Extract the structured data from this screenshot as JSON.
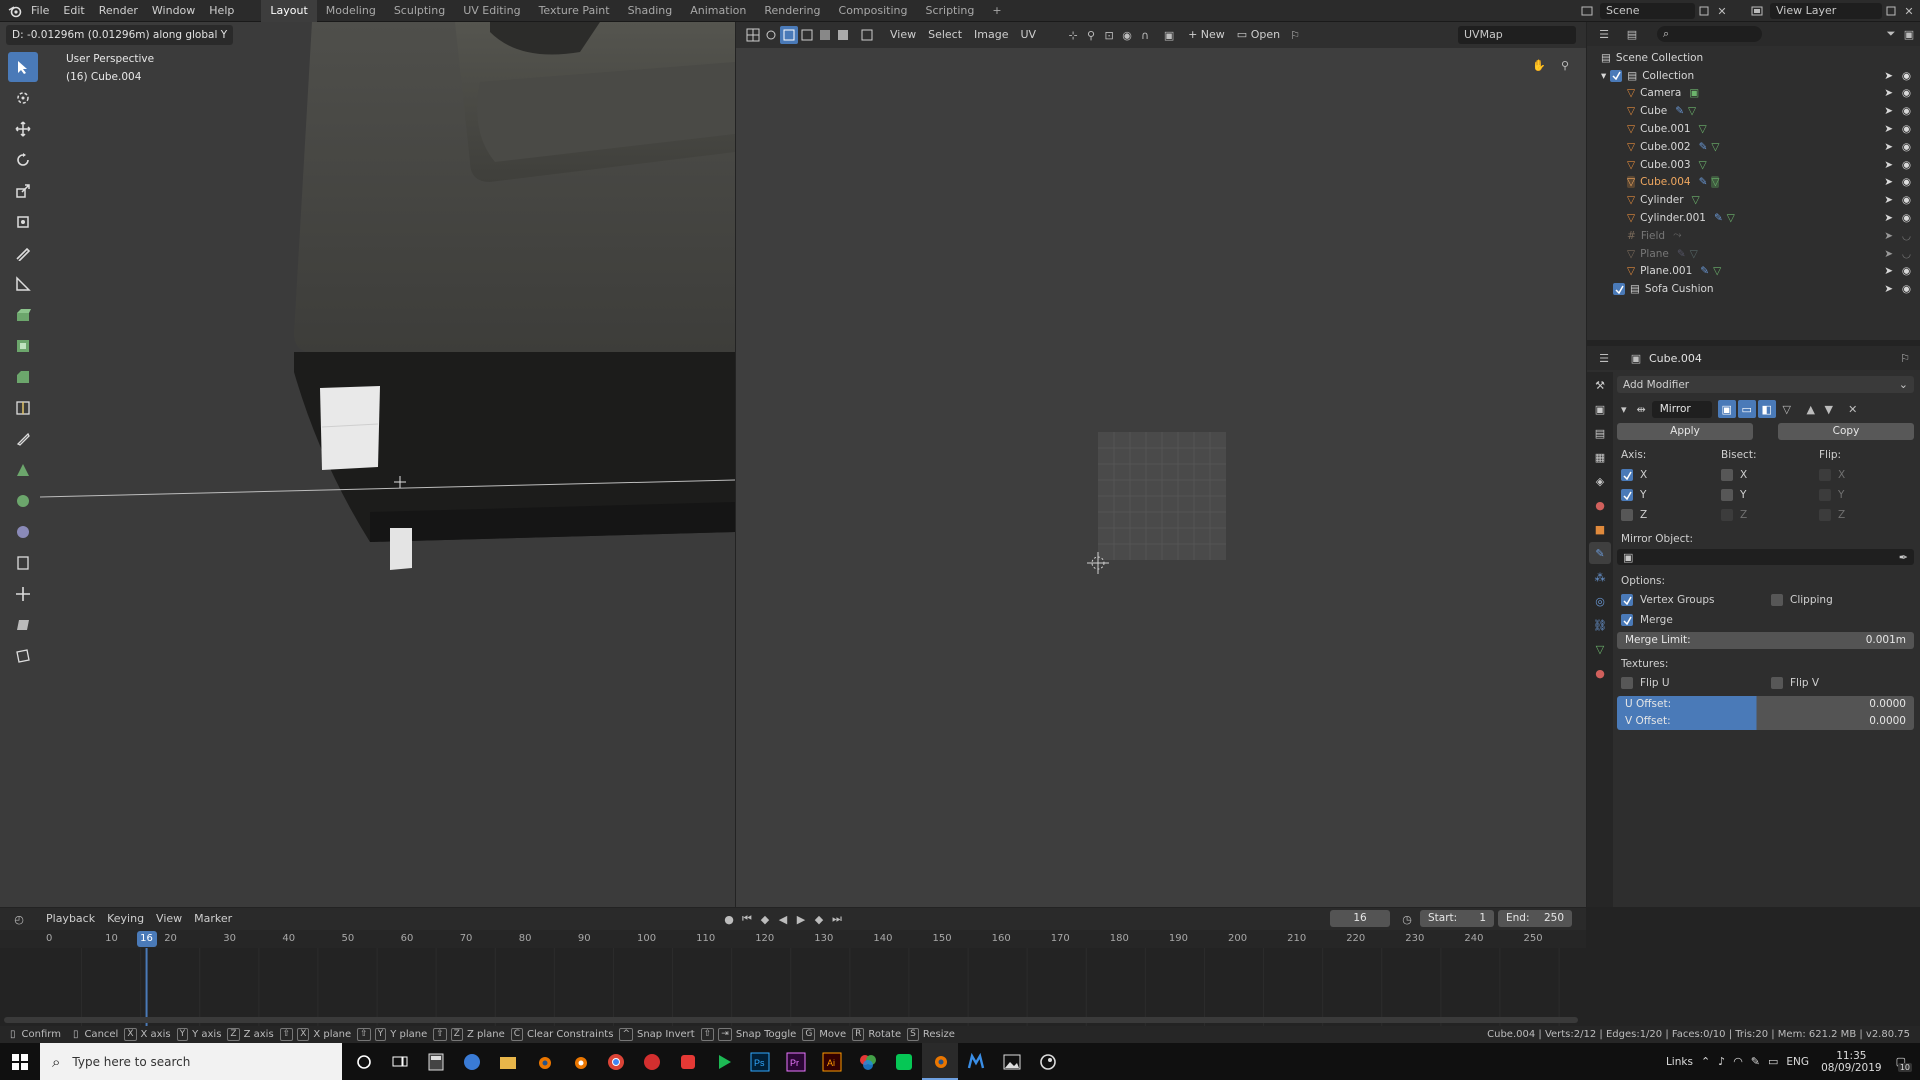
{
  "app": {
    "menus": [
      "File",
      "Edit",
      "Render",
      "Window",
      "Help"
    ],
    "workspaces": [
      "Layout",
      "Modeling",
      "Sculpting",
      "UV Editing",
      "Texture Paint",
      "Shading",
      "Animation",
      "Rendering",
      "Compositing",
      "Scripting"
    ],
    "add_workspace": "+",
    "scene_label": "Scene",
    "view_layer_label": "View Layer"
  },
  "viewport": {
    "operator_text": "D: -0.01296m (0.01296m) along global Y",
    "perspective": "User Perspective",
    "object_label": "(16) Cube.004"
  },
  "uv_editor": {
    "menus": [
      "View",
      "Select",
      "Image",
      "UV"
    ],
    "new_label": "New",
    "open_label": "Open",
    "uvmap": "UVMap"
  },
  "outliner": {
    "root": "Scene Collection",
    "collection": "Collection",
    "items": [
      {
        "name": "Camera"
      },
      {
        "name": "Cube"
      },
      {
        "name": "Cube.001"
      },
      {
        "name": "Cube.002"
      },
      {
        "name": "Cube.003"
      },
      {
        "name": "Cube.004"
      },
      {
        "name": "Cylinder"
      },
      {
        "name": "Cylinder.001"
      },
      {
        "name": "Field"
      },
      {
        "name": "Plane"
      },
      {
        "name": "Plane.001"
      }
    ],
    "sofa": "Sofa Cushion"
  },
  "properties": {
    "object_name": "Cube.004",
    "add_modifier": "Add Modifier",
    "modifier_name": "Mirror",
    "apply": "Apply",
    "copy": "Copy",
    "axis_label": "Axis:",
    "bisect_label": "Bisect:",
    "flip_label": "Flip:",
    "x": "X",
    "y": "Y",
    "z": "Z",
    "mirror_object": "Mirror Object:",
    "options": "Options:",
    "vertex_groups": "Vertex Groups",
    "clipping": "Clipping",
    "merge": "Merge",
    "merge_limit_label": "Merge Limit:",
    "merge_limit_value": "0.001m",
    "textures": "Textures:",
    "flip_u": "Flip U",
    "flip_v": "Flip V",
    "u_offset_label": "U Offset:",
    "u_offset_value": "0.0000",
    "v_offset_label": "V Offset:",
    "v_offset_value": "0.0000"
  },
  "timeline": {
    "menus": [
      "Playback",
      "Keying",
      "View",
      "Marker"
    ],
    "current_frame": "16",
    "start_label": "Start:",
    "start_value": "1",
    "end_label": "End:",
    "end_value": "250",
    "ticks": [
      "0",
      "10",
      "20",
      "30",
      "40",
      "50",
      "60",
      "70",
      "80",
      "90",
      "100",
      "110",
      "120",
      "130",
      "140",
      "150",
      "160",
      "170",
      "180",
      "190",
      "200",
      "210",
      "220",
      "230",
      "240",
      "250"
    ]
  },
  "statusbar": {
    "confirm": "Confirm",
    "cancel": "Cancel",
    "x_axis": "X axis",
    "y_axis": "Y axis",
    "z_axis": "Z axis",
    "x_plane": "X plane",
    "y_plane": "Y plane",
    "z_plane": "Z plane",
    "clear_constraints": "Clear Constraints",
    "snap_invert": "Snap Invert",
    "snap_toggle": "Snap Toggle",
    "move": "Move",
    "rotate": "Rotate",
    "resize": "Resize",
    "stats": "Cube.004 | Verts:2/12 | Edges:1/20 | Faces:0/10 | Tris:20 | Mem: 621.2 MB | v2.80.75"
  },
  "taskbar": {
    "search_placeholder": "Type here to search",
    "links": "Links",
    "lang": "ENG",
    "time": "11:35",
    "date": "08/09/2019",
    "notif_count": "10"
  }
}
